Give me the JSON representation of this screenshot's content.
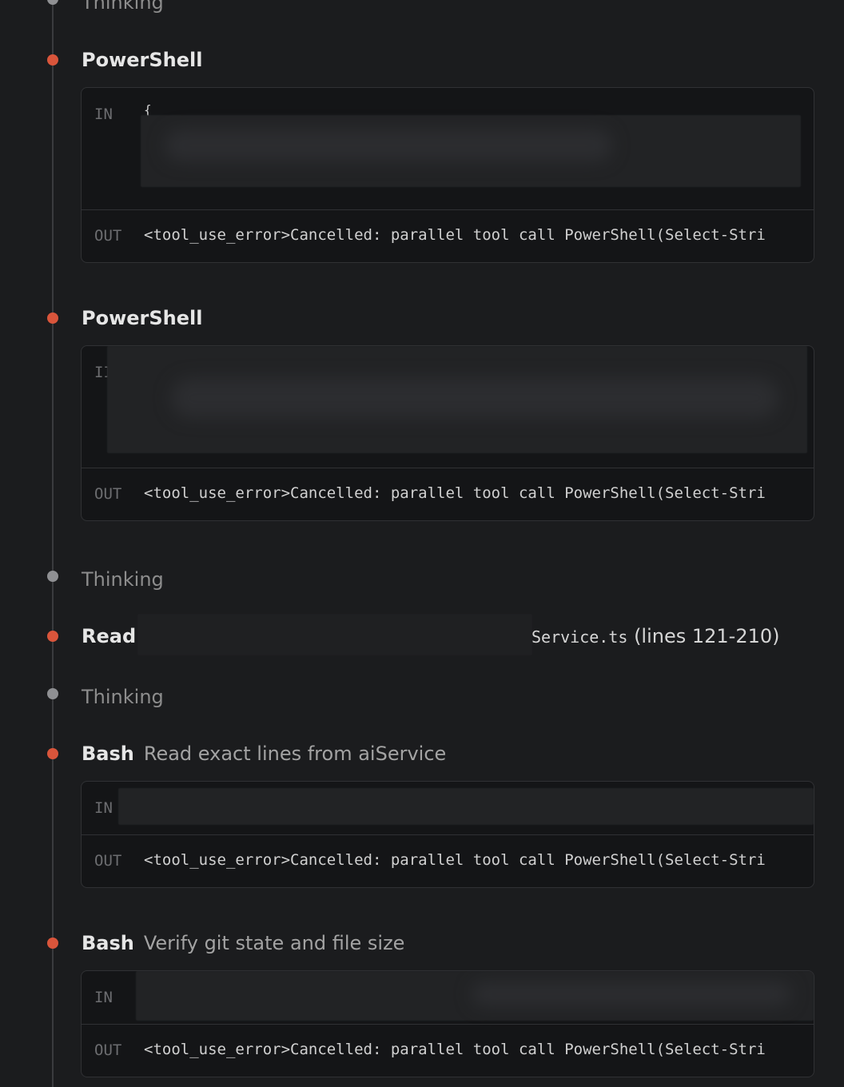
{
  "steps": [
    {
      "kind": "thinking",
      "label": "Thinking"
    },
    {
      "kind": "tool",
      "name": "PowerShell",
      "in_label": "IN",
      "in_visible": "{",
      "out_label": "OUT",
      "out_text": "<tool_use_error>Cancelled: parallel tool call PowerShell(Select-Stri"
    },
    {
      "kind": "tool",
      "name": "PowerShell",
      "in_label": "II",
      "out_label": "OUT",
      "out_text": "<tool_use_error>Cancelled: parallel tool call PowerShell(Select-Stri"
    },
    {
      "kind": "thinking",
      "label": "Thinking"
    },
    {
      "kind": "read",
      "name": "Read",
      "file_suffix": "Service.ts",
      "range": "(lines 121-210)"
    },
    {
      "kind": "thinking",
      "label": "Thinking"
    },
    {
      "kind": "tool",
      "name": "Bash",
      "description": "Read exact lines from aiService",
      "in_label": "IN",
      "out_label": "OUT",
      "out_text": "<tool_use_error>Cancelled: parallel tool call PowerShell(Select-Stri"
    },
    {
      "kind": "tool",
      "name": "Bash",
      "description": "Verify git state and file size",
      "in_label": "IN",
      "out_label": "OUT",
      "out_text": "<tool_use_error>Cancelled: parallel tool call PowerShell(Select-Stri"
    }
  ],
  "colors": {
    "tool_dot": "#d9553b",
    "thinking_dot": "#8f9093",
    "background": "#1b1c1e"
  }
}
